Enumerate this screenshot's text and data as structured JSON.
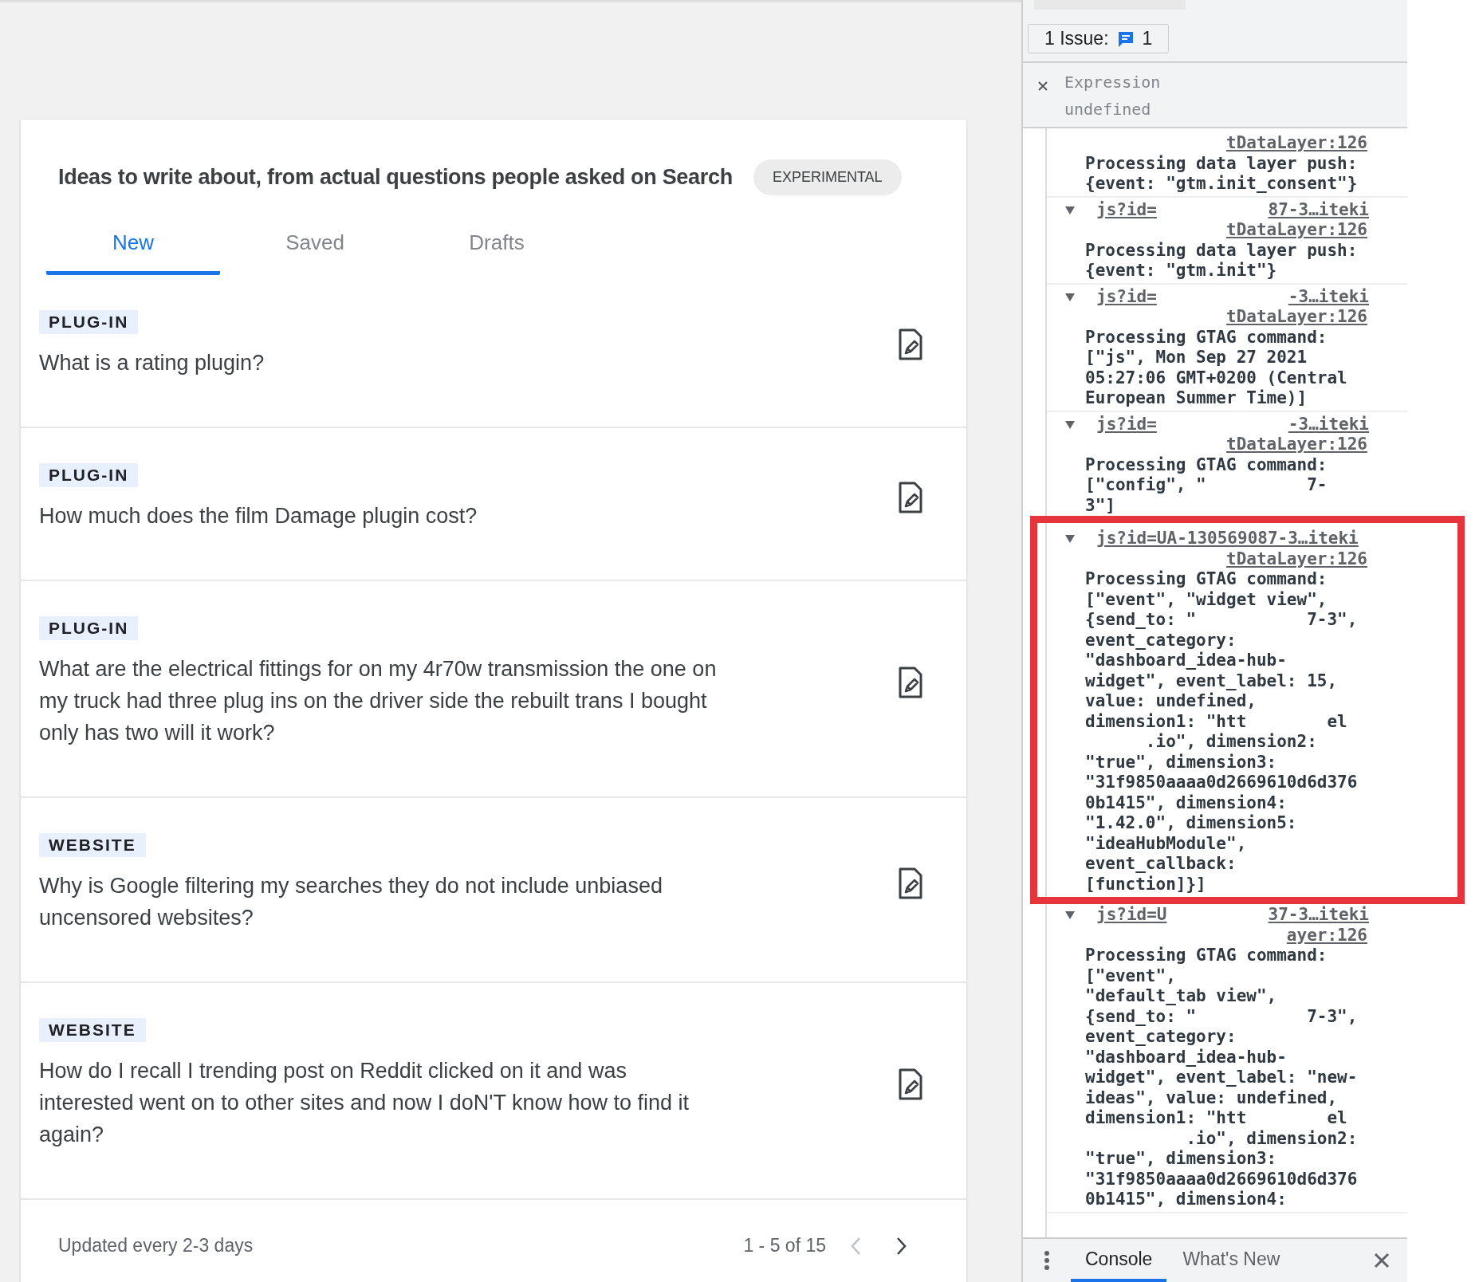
{
  "widget": {
    "title": "Ideas to write about, from actual questions people asked on Search",
    "badge": "EXPERIMENTAL",
    "tabs": [
      {
        "label": "New",
        "selected": true
      },
      {
        "label": "Saved",
        "selected": false
      },
      {
        "label": "Drafts",
        "selected": false
      }
    ],
    "ideas": [
      {
        "tag": "PLUG-IN",
        "question": "What is a rating plugin?"
      },
      {
        "tag": "PLUG-IN",
        "question": "How much does the film Damage plugin cost?"
      },
      {
        "tag": "PLUG-IN",
        "question": "What are the electrical fittings for on my 4r70w transmission the one on my truck had three plug ins on the driver side the rebuilt trans I bought only has two will it work?"
      },
      {
        "tag": "WEBSITE",
        "question": "Why is Google filtering my searches they do not include unbiased uncensored websites?"
      },
      {
        "tag": "WEBSITE",
        "question": "How do I recall I trending post on Reddit clicked on it and was interested went on to other sites and now I doN'T know how to find it again?"
      }
    ],
    "footer": {
      "note": "Updated every 2-3 days",
      "range": "1 - 5 of 15",
      "prev_disabled": true
    }
  },
  "devtools": {
    "issues": {
      "label": "1 Issue:",
      "count": "1"
    },
    "expression": {
      "name": "Expression",
      "value": "undefined"
    },
    "entries": [
      {
        "kind": "continued",
        "source": "tDataLayer:126",
        "lines": [
          "Processing data layer push:",
          "{event: \"gtm.init_consent\"}"
        ]
      },
      {
        "kind": "group",
        "link": [
          "js?id=",
          "87-3…iteki"
        ],
        "source": "tDataLayer:126",
        "lines": [
          "Processing data layer push:",
          "{event: \"gtm.init\"}"
        ]
      },
      {
        "kind": "group",
        "link": [
          "js?id=",
          "-3…iteki"
        ],
        "source": "tDataLayer:126",
        "lines": [
          "Processing GTAG command:",
          "[\"js\", Mon Sep 27 2021",
          "05:27:06 GMT+0200 (Central",
          "European Summer Time)]"
        ]
      },
      {
        "kind": "group",
        "link": [
          "js?id=",
          "-3…iteki"
        ],
        "source": "tDataLayer:126",
        "lines": [
          "Processing GTAG command:",
          "[\"config\", \"          7-",
          "3\"]"
        ]
      },
      {
        "kind": "group",
        "link": [
          "js?id=UA-130569087-3…iteki"
        ],
        "source": "tDataLayer:126",
        "highlighted": true,
        "lines": [
          "Processing GTAG command:",
          "[\"event\", \"widget view\",",
          "{send_to: \"           7-3\",",
          "event_category:",
          "\"dashboard_idea-hub-",
          "widget\", event_label: 15,",
          "value: undefined,",
          "dimension1: \"htt        el",
          "      .io\", dimension2:",
          "\"true\", dimension3:",
          "\"31f9850aaaa0d2669610d6d376",
          "0b1415\", dimension4:",
          "\"1.42.0\", dimension5:",
          "\"ideaHubModule\",",
          "event_callback:",
          "[function]}]"
        ]
      },
      {
        "kind": "group",
        "link": [
          "js?id=U",
          "37-3…iteki"
        ],
        "source": "ayer:126",
        "lines": [
          "Processing GTAG command:",
          "[\"event\",",
          "\"default_tab view\",",
          "{send_to: \"           7-3\",",
          "event_category:",
          "\"dashboard_idea-hub-",
          "widget\", event_label: \"new-",
          "ideas\", value: undefined,",
          "dimension1: \"htt        el",
          "          .io\", dimension2:",
          "\"true\", dimension3:",
          "\"31f9850aaaa0d2669610d6d376",
          "0b1415\", dimension4:"
        ]
      }
    ],
    "drawer_tabs": [
      {
        "label": "Console",
        "selected": true
      },
      {
        "label": "What's New",
        "selected": false
      }
    ]
  }
}
